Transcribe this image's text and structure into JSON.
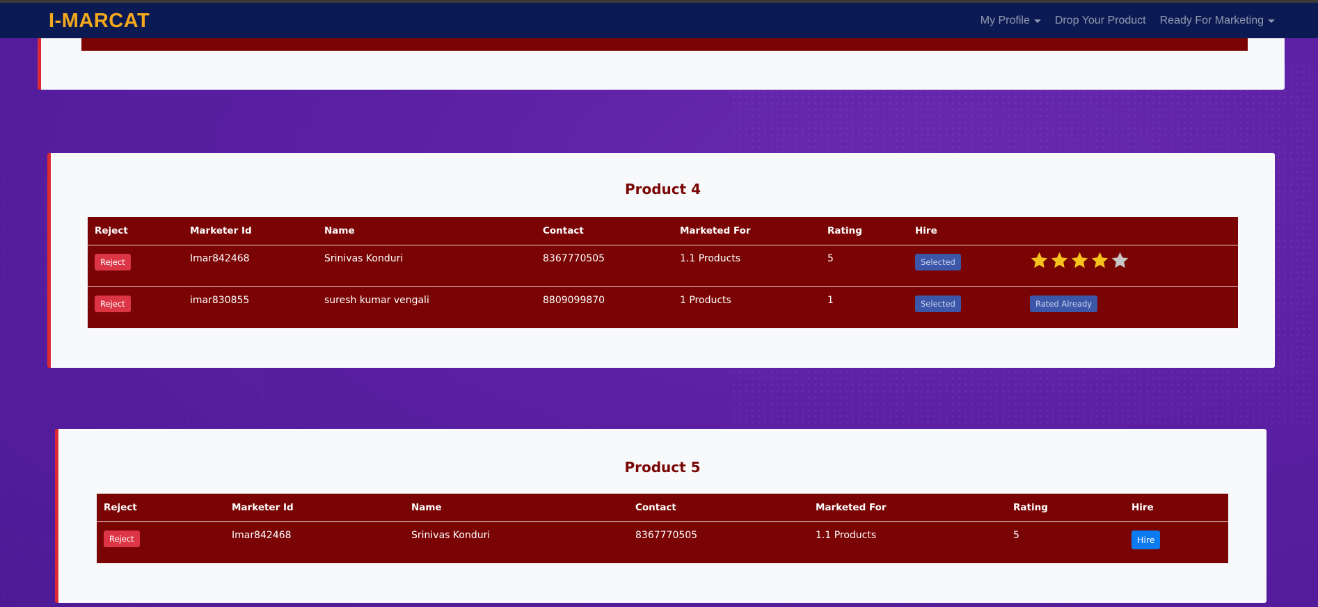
{
  "navbar": {
    "brand": "I-MARCAT",
    "links": [
      {
        "label": "My Profile",
        "dropdown": true
      },
      {
        "label": "Drop Your Product",
        "dropdown": false
      },
      {
        "label": "Ready For Marketing",
        "dropdown": true
      }
    ]
  },
  "colors": {
    "navbar_bg": "#0b1a52",
    "brand": "#f4a81c",
    "table_bg": "#7a0404",
    "accent_border": "#dc2a35",
    "reject": "#dc3545",
    "selected": "#3d57a8",
    "hire": "#0d7bf0",
    "star_filled": "#f6c21b",
    "star_empty": "#c8c8c8"
  },
  "products": [
    {
      "title": "Product 4",
      "columns": [
        "Reject",
        "Marketer Id",
        "Name",
        "Contact",
        "Marketed For",
        "Rating",
        "Hire",
        ""
      ],
      "rows": [
        {
          "reject_label": "Reject",
          "marketer_id": "Imar842468",
          "name": "Srinivas Konduri",
          "contact": "8367770505",
          "marketed_for": "1.1 Products",
          "rating": "5",
          "hire_label": "Selected",
          "stars_filled": 4,
          "stars_total": 5
        },
        {
          "reject_label": "Reject",
          "marketer_id": "imar830855",
          "name": "suresh kumar vengali",
          "contact": "8809099870",
          "marketed_for": "1 Products",
          "rating": "1",
          "hire_label": "Selected",
          "rated_label": "Rated Already"
        }
      ]
    },
    {
      "title": "Product 5",
      "columns": [
        "Reject",
        "Marketer Id",
        "Name",
        "Contact",
        "Marketed For",
        "Rating",
        "Hire"
      ],
      "rows": [
        {
          "reject_label": "Reject",
          "marketer_id": "Imar842468",
          "name": "Srinivas Konduri",
          "contact": "8367770505",
          "marketed_for": "1.1 Products",
          "rating": "5",
          "hire_label": "Hire"
        }
      ]
    }
  ]
}
